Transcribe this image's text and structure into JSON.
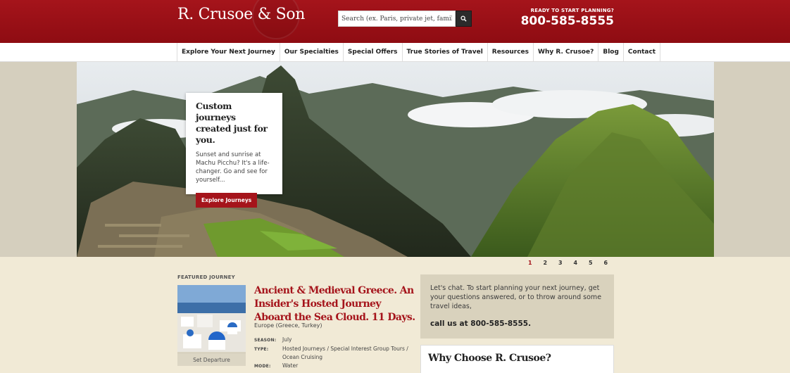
{
  "header": {
    "logo": "R. Crusoe & Son",
    "search_placeholder": "Search (ex. Paris, private jet, family)",
    "ready_label": "READY TO START PLANNING?",
    "phone": "800-585-8555"
  },
  "nav": {
    "items": [
      {
        "label": "Explore Your Next Journey"
      },
      {
        "label": "Our Specialties"
      },
      {
        "label": "Special Offers"
      },
      {
        "label": "True Stories of Travel"
      },
      {
        "label": "Resources"
      },
      {
        "label": "Why R. Crusoe?"
      },
      {
        "label": "Blog"
      },
      {
        "label": "Contact"
      }
    ]
  },
  "hero": {
    "title": "Custom journeys created just for you.",
    "text": "Sunset and sunrise at Machu Picchu? It's a life-changer. Go and see for yourself...",
    "button": "Explore Journeys",
    "pages": [
      "1",
      "2",
      "3",
      "4",
      "5",
      "6"
    ],
    "active_page": "1"
  },
  "featured": {
    "label": "FEATURED JOURNEY",
    "title": "Ancient & Medieval Greece. An Insider's Hosted Journey Aboard the Sea Cloud. 11 Days.",
    "region": "Europe (Greece, Turkey)",
    "image_caption": "Set Departure",
    "meta": [
      {
        "key": "SEASON:",
        "value": "July"
      },
      {
        "key": "TYPE:",
        "value": "Hosted Journeys / Special Interest Group Tours / Ocean Cruising"
      },
      {
        "key": "MODE:",
        "value": "Water"
      }
    ]
  },
  "chat": {
    "text": "Let's chat. To start planning your next journey, get your questions answered, or to throw around some travel ideas,",
    "call": "call us at 800-585-8555."
  },
  "why": {
    "title": "Why Choose R. Crusoe?"
  },
  "colors": {
    "brand_red": "#a5141b",
    "cream": "#f1ead6",
    "tan": "#d9d2bd"
  }
}
